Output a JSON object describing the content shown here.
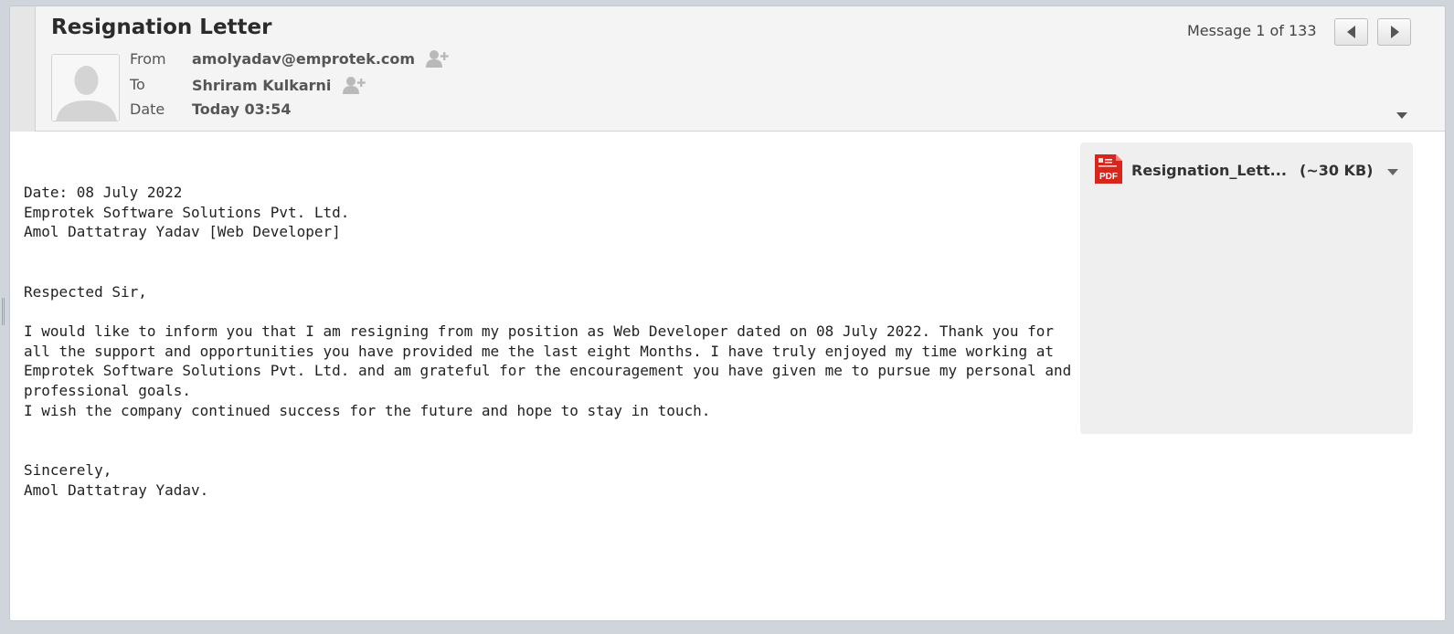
{
  "message": {
    "subject": "Resignation Letter",
    "counter": "Message 1 of 133"
  },
  "headers": {
    "from_label": "From",
    "from_value": "amolyadav@emprotek.com",
    "to_label": "To",
    "to_value": "Shriram Kulkarni",
    "date_label": "Date",
    "date_value": "Today 03:54"
  },
  "icons": {
    "avatar": "person-silhouette-icon",
    "add_contact": "add-contact-icon",
    "prev": "triangle-left-icon",
    "next": "triangle-right-icon",
    "header_toggle": "caret-down-icon",
    "attachment": "pdf-icon"
  },
  "body": {
    "text": "Date: 08 July 2022\nEmprotek Software Solutions Pvt. Ltd.\nAmol Dattatray Yadav [Web Developer]\n\n\nRespected Sir,\n\nI would like to inform you that I am resigning from my position as Web Developer dated on 08 July 2022. Thank you for all the support and opportunities you have provided me the last eight Months. I have truly enjoyed my time working at Emprotek Software Solutions Pvt. Ltd. and am grateful for the encouragement you have given me to pursue my personal and professional goals.\nI wish the company continued success for the future and hope to stay in touch.\n\n\nSincerely,\nAmol Dattatray Yadav."
  },
  "attachment": {
    "name": "Resignation_Lett...",
    "size": "(~30 KB)",
    "icon_label": "PDF"
  },
  "colors": {
    "pdf_red": "#d9261c",
    "header_bg": "#f4f4f4",
    "attachment_panel": "#efefef"
  }
}
